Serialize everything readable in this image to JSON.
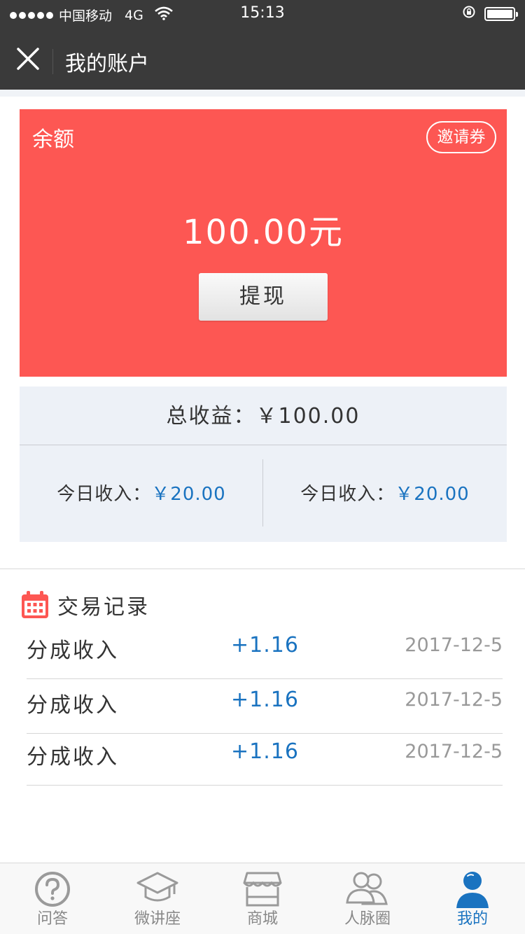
{
  "status_bar": {
    "carrier": "中国移动",
    "network": "4G",
    "time": "15:13"
  },
  "nav": {
    "title": "我的账户"
  },
  "balance": {
    "label": "余额",
    "coupon_label": "邀请券",
    "amount": "100.00元",
    "withdraw_label": "提现"
  },
  "summary": {
    "total_label": "总收益：",
    "total_value": "￥100.00",
    "left_label": "今日收入：",
    "left_value": "￥20.00",
    "right_label": "今日收入：",
    "right_value": "￥20.00"
  },
  "records": {
    "title": "交易记录",
    "items": [
      {
        "name": "分成收入",
        "value": "+1.16",
        "date": "2017-12-5"
      },
      {
        "name": "分成收入",
        "value": "+1.16",
        "date": "2017-12-5"
      },
      {
        "name": "分成收入",
        "value": "+1.16",
        "date": "2017-12-5"
      }
    ]
  },
  "tabs": [
    {
      "label": "问答",
      "icon": "question-icon"
    },
    {
      "label": "微讲座",
      "icon": "graduation-cap-icon"
    },
    {
      "label": "商城",
      "icon": "store-icon"
    },
    {
      "label": "人脉圈",
      "icon": "people-icon"
    },
    {
      "label": "我的",
      "icon": "user-icon",
      "active": true
    }
  ],
  "colors": {
    "accent_red": "#fd5753",
    "accent_blue": "#1a73c0",
    "bar_dark": "#3a3a3a"
  }
}
